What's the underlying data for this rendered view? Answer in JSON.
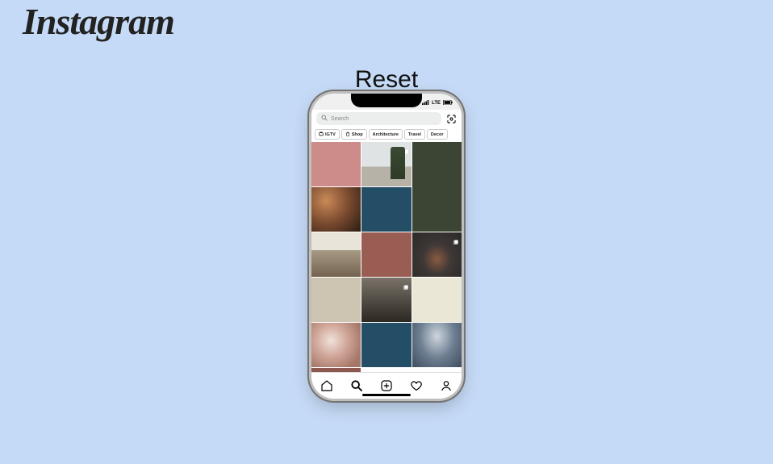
{
  "page": {
    "brand": "Instagram",
    "title": "Reset"
  },
  "status": {
    "carrier": "LTE",
    "signal": "●●●●",
    "battery": "■"
  },
  "search": {
    "placeholder": "Search"
  },
  "chips": [
    {
      "icon": "tv",
      "label": "IGTV"
    },
    {
      "icon": "bag",
      "label": "Shop"
    },
    {
      "icon": "",
      "label": "Architecture"
    },
    {
      "icon": "",
      "label": "Travel"
    },
    {
      "icon": "",
      "label": "Decor"
    }
  ],
  "grid": {
    "tiles": [
      {
        "name": "pink-solid",
        "multi": false,
        "tall": false
      },
      {
        "name": "architecture-trees",
        "multi": true,
        "tall": false
      },
      {
        "name": "dark-green",
        "multi": false,
        "tall": true
      },
      {
        "name": "vessel-structure",
        "multi": false,
        "tall": false
      },
      {
        "name": "navy-solid",
        "multi": false,
        "tall": false
      },
      {
        "name": "interior-room",
        "multi": false,
        "tall": false
      },
      {
        "name": "rust-solid",
        "multi": false,
        "tall": false
      },
      {
        "name": "pagoda-temple",
        "multi": true,
        "tall": false
      },
      {
        "name": "beige-tone",
        "multi": false,
        "tall": false
      },
      {
        "name": "train-platform",
        "multi": true,
        "tall": false
      },
      {
        "name": "cream-solid",
        "multi": false,
        "tall": false
      },
      {
        "name": "flower-table",
        "multi": false,
        "tall": false
      },
      {
        "name": "navy-solid-2",
        "multi": false,
        "tall": false
      },
      {
        "name": "storm-clouds",
        "multi": false,
        "tall": false
      },
      {
        "name": "rust-solid-2",
        "multi": false,
        "tall": false
      }
    ]
  },
  "nav": {
    "home": "home-icon",
    "search": "search-icon",
    "add": "add-post-icon",
    "activity": "heart-icon",
    "profile": "profile-icon",
    "active": "search"
  }
}
